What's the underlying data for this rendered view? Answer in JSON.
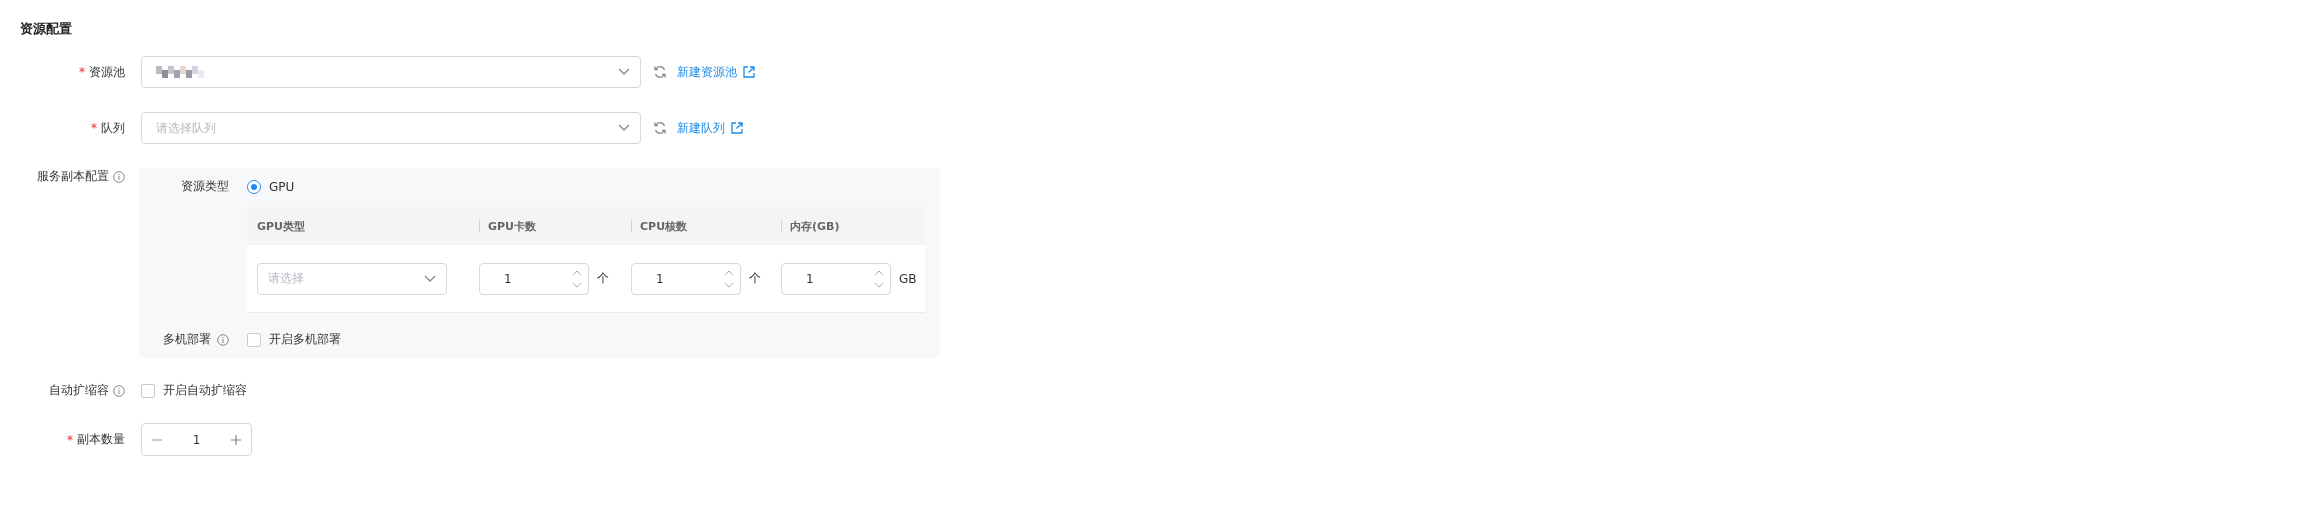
{
  "section_title": "资源配置",
  "resource_pool": {
    "required_mark": "*",
    "label": "资源池",
    "link": "新建资源池"
  },
  "queue": {
    "required_mark": "*",
    "label": "队列",
    "placeholder": "请选择队列",
    "link": "新建队列"
  },
  "replica_config": {
    "label": "服务副本配置",
    "resource_type": {
      "label": "资源类型",
      "options": [
        {
          "label": "GPU",
          "selected": true
        }
      ]
    },
    "table": {
      "columns": [
        "GPU类型",
        "GPU卡数",
        "CPU核数",
        "内存(GB)"
      ],
      "cells": [
        {
          "kind": "select",
          "placeholder": "请选择"
        },
        {
          "kind": "number",
          "value": "1",
          "unit": "个"
        },
        {
          "kind": "number",
          "value": "1",
          "unit": "个"
        },
        {
          "kind": "number",
          "value": "1",
          "unit": "GB"
        }
      ]
    },
    "multi_node": {
      "label": "多机部署",
      "checkbox": {
        "label": "开启多机部署",
        "checked": false
      }
    }
  },
  "autoscale": {
    "label": "自动扩缩容",
    "checkbox": {
      "label": "开启自动扩缩容",
      "checked": false
    }
  },
  "replicas": {
    "required_mark": "*",
    "label": "副本数量",
    "value": "1"
  }
}
